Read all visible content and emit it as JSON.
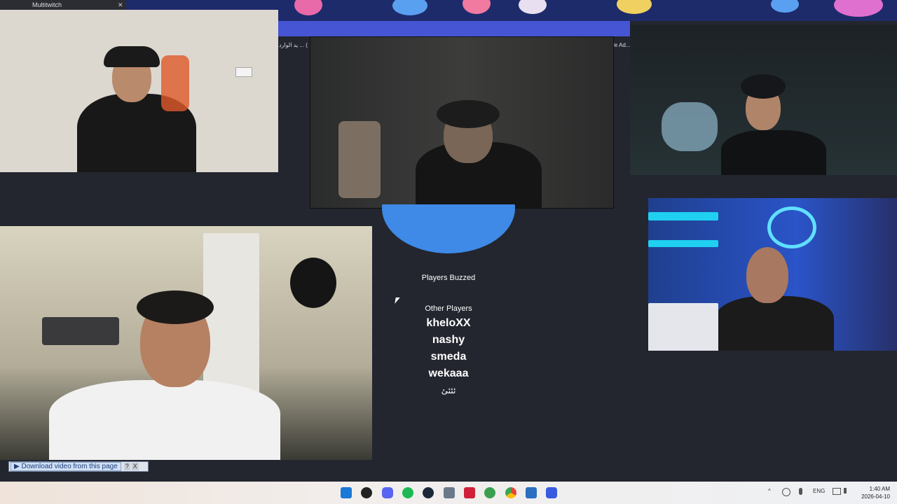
{
  "browser_tab": {
    "title": "Multitwitch",
    "close_label": "✕"
  },
  "ticker": {
    "left_text": "يد الوارد ... (",
    "right_text": "le Ad..."
  },
  "quiz": {
    "buzzed_heading": "Players Buzzed",
    "other_heading": "Other Players",
    "other_players": [
      "kheloXX",
      "nashy",
      "smeda",
      "wekaaa",
      "ئئئئ"
    ]
  },
  "download_bar": {
    "label": "Download video from this page",
    "help": "?",
    "close": "X"
  },
  "taskbar": {
    "icons": [
      "windows-start-icon",
      "obs-icon",
      "discord-icon",
      "spotify-icon",
      "steam-icon",
      "calculator-icon",
      "game-icon",
      "globe-icon",
      "chrome-icon",
      "remote-icon",
      "ea-icon"
    ],
    "language": "ENG",
    "time": "1:40 AM",
    "date": "2026-04-10"
  }
}
